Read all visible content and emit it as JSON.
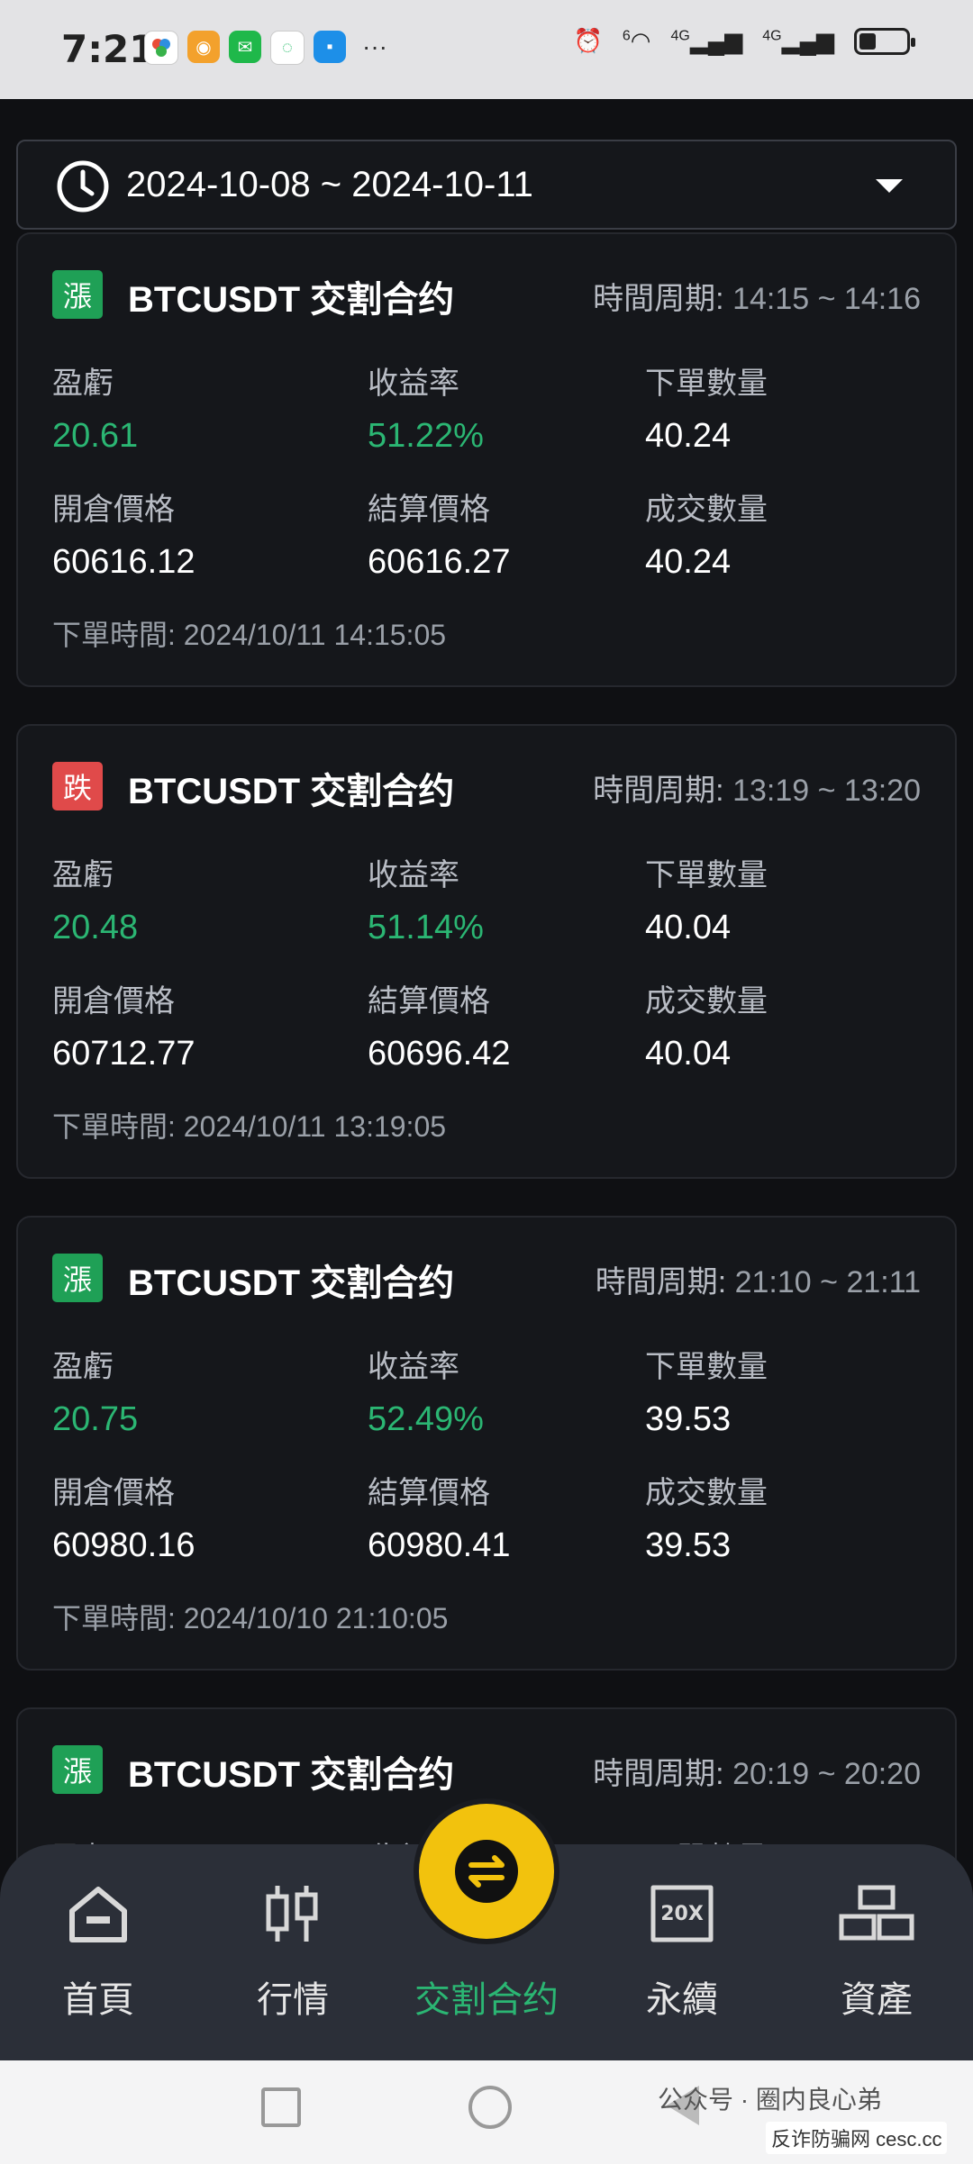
{
  "status_bar": {
    "time": "7:21",
    "more": "···",
    "signal_1": "4G",
    "signal_2": "4G",
    "wifi_badge": "6"
  },
  "filter": {
    "date_range": "2024-10-08 ~ 2024-10-11"
  },
  "labels": {
    "pnl": "盈虧",
    "yield": "收益率",
    "order_qty": "下單數量",
    "open_price": "開倉價格",
    "settle_price": "結算價格",
    "filled_qty": "成交數量",
    "order_time": "下單時間:",
    "period": "時間周期:"
  },
  "orders": [
    {
      "tag": "漲",
      "direction": "up",
      "symbol": "BTCUSDT 交割合约",
      "period": "14:15 ~ 14:16",
      "pnl": "20.61",
      "yield": "51.22%",
      "order_qty": "40.24",
      "open_price": "60616.12",
      "settle_price": "60616.27",
      "filled_qty": "40.24",
      "order_time": "2024/10/11 14:15:05"
    },
    {
      "tag": "跌",
      "direction": "down",
      "symbol": "BTCUSDT 交割合约",
      "period": "13:19 ~ 13:20",
      "pnl": "20.48",
      "yield": "51.14%",
      "order_qty": "40.04",
      "open_price": "60712.77",
      "settle_price": "60696.42",
      "filled_qty": "40.04",
      "order_time": "2024/10/11 13:19:05"
    },
    {
      "tag": "漲",
      "direction": "up",
      "symbol": "BTCUSDT 交割合约",
      "period": "21:10 ~ 21:11",
      "pnl": "20.75",
      "yield": "52.49%",
      "order_qty": "39.53",
      "open_price": "60980.16",
      "settle_price": "60980.41",
      "filled_qty": "39.53",
      "order_time": "2024/10/10 21:10:05"
    },
    {
      "tag": "漲",
      "direction": "up",
      "symbol": "BTCUSDT 交割合约",
      "period": "20:19 ~ 20:20"
    }
  ],
  "nav": {
    "items": [
      {
        "label": "首頁",
        "icon": "home-icon"
      },
      {
        "label": "行情",
        "icon": "candlestick-icon"
      },
      {
        "label": "交割合约",
        "icon": "swap-icon",
        "active": true
      },
      {
        "label": "永續",
        "icon": "leverage-20x-icon"
      },
      {
        "label": "資產",
        "icon": "gold-bars-icon"
      }
    ],
    "badge_20x": "20X"
  },
  "watermark": {
    "line1": "公众号 · 圈内良心弟",
    "line2": "反诈防骗网 cesc.cc"
  },
  "colors": {
    "green": "#2bb673",
    "red": "#e04a4a",
    "accent": "#f2c20d",
    "card_bg": "#15171b"
  }
}
